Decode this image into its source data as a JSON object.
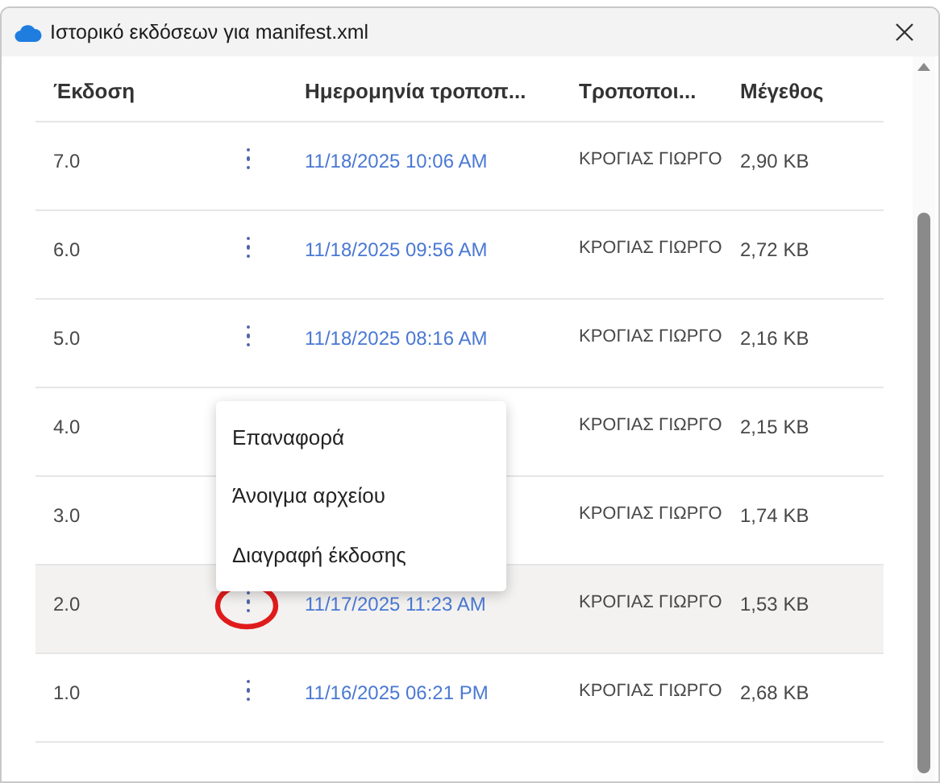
{
  "window": {
    "title": "Ιστορικό εκδόσεων για manifest.xml"
  },
  "table": {
    "columns": [
      "Έκδοση",
      "Ημερομηνία τροποπ...",
      "Τροποποι...",
      "Μέγεθος"
    ],
    "rows": [
      {
        "version": "7.0",
        "more_button": true,
        "date": "11/18/2025 10:06 AM",
        "modified_by": "ΚΡΟΓΙΑΣ ΓΙΩΡΓΟ",
        "size": "2,90 KB",
        "selected": false,
        "circled": false
      },
      {
        "version": "6.0",
        "more_button": true,
        "date": "11/18/2025 09:56 AM",
        "modified_by": "ΚΡΟΓΙΑΣ ΓΙΩΡΓΟ",
        "size": "2,72 KB",
        "selected": false,
        "circled": false
      },
      {
        "version": "5.0",
        "more_button": true,
        "date": "11/18/2025 08:16 AM",
        "modified_by": "ΚΡΟΓΙΑΣ ΓΙΩΡΓΟ",
        "size": "2,16 KB",
        "selected": false,
        "circled": false
      },
      {
        "version": "4.0",
        "modified_by": "ΚΡΟΓΙΑΣ ΓΙΩΡΓΟ",
        "size": "2,15 KB",
        "selected": false,
        "circled": false
      },
      {
        "version": "3.0",
        "modified_by": "ΚΡΟΓΙΑΣ ΓΙΩΡΓΟ",
        "size": "1,74 KB",
        "selected": false,
        "circled": false
      },
      {
        "version": "2.0",
        "more_button": true,
        "date": "11/17/2025 11:23 AM",
        "modified_by": "ΚΡΟΓΙΑΣ ΓΙΩΡΓΟ",
        "size": "1,53 KB",
        "selected": true,
        "circled": true
      },
      {
        "version": "1.0",
        "more_button": true,
        "date": "11/16/2025 06:21 PM",
        "modified_by": "ΚΡΟΓΙΑΣ ΓΙΩΡΓΟ",
        "size": "2,68 KB",
        "selected": false,
        "circled": false
      }
    ]
  },
  "context_menu": {
    "items": [
      "Επαναφορά",
      "Άνοιγμα αρχείου",
      "Διαγραφή έκδοσης"
    ]
  }
}
